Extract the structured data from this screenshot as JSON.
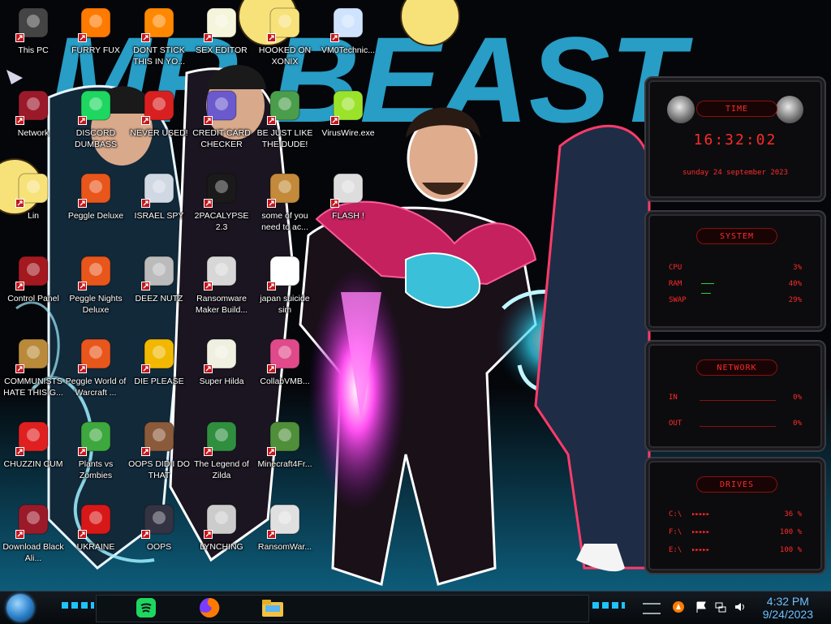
{
  "desktop": {
    "icons": [
      {
        "label": "This PC",
        "glyph": "computer-icon",
        "color": "#444"
      },
      {
        "label": "FURRY FUX",
        "glyph": "firefox-icon",
        "color": "#ff7a00"
      },
      {
        "label": "DONT STICK THIS IN YO...",
        "glyph": "vlc-icon",
        "color": "#ff8800"
      },
      {
        "label": "SEX EDITOR",
        "glyph": "editor-icon",
        "color": "#f5f5dc"
      },
      {
        "label": "HOOKED ON XONIX",
        "glyph": "cartoon-face-icon",
        "color": "#f7e27a"
      },
      {
        "label": "VM0Technic...",
        "glyph": "person-icon",
        "color": "#cfe3ff"
      },
      {
        "label": "Network",
        "glyph": "alien-orb-icon",
        "color": "#9b1a2a"
      },
      {
        "label": "DISCORD DUMBASS",
        "glyph": "spotify-icon",
        "color": "#1ed760"
      },
      {
        "label": "NEVER USED!",
        "glyph": "dev-cpp-icon",
        "color": "#d92020"
      },
      {
        "label": "CREDIT CARD CHECKER",
        "glyph": "credit-card-icon",
        "color": "#6a5acd"
      },
      {
        "label": "BE JUST LIKE THE DUDE!",
        "glyph": "character-icon",
        "color": "#4a9d4a"
      },
      {
        "label": "VirusWire.exe",
        "glyph": "lime-icon",
        "color": "#9be32b"
      },
      {
        "label": "Lin",
        "glyph": "cartoon-girl-icon",
        "color": "#f7e27a"
      },
      {
        "label": "Peggle Deluxe",
        "glyph": "peggle-icon",
        "color": "#e8561c"
      },
      {
        "label": "ISRAEL SPY",
        "glyph": "network-drive-icon",
        "color": "#cfd8e3"
      },
      {
        "label": "2PACALYPSE 2.3",
        "glyph": "terminal-icon",
        "color": "#1a1a1a"
      },
      {
        "label": "some of you need to ac...",
        "glyph": "dog-icon",
        "color": "#c28a3a"
      },
      {
        "label": "FLASH !",
        "glyph": "flash-icon",
        "color": "#dddddd"
      },
      {
        "label": "Control Panel",
        "glyph": "control-panel-icon",
        "color": "#a41820"
      },
      {
        "label": "Peggle Nights Deluxe",
        "glyph": "peggle-icon",
        "color": "#e8561c"
      },
      {
        "label": "DEEZ NUTZ",
        "glyph": "windows-stack-icon",
        "color": "#bbbbbb"
      },
      {
        "label": "Ransomware Maker Build...",
        "glyph": "app-window-icon",
        "color": "#d7d7d7"
      },
      {
        "label": "japan suicide sim",
        "glyph": "document-icon",
        "color": "#ffffff"
      },
      {
        "label": "COMMUNISTS HATE THIS G...",
        "glyph": "money-bag-icon",
        "color": "#b98a3a"
      },
      {
        "label": "Peggle World of Warcraft ...",
        "glyph": "peggle-icon",
        "color": "#e8561c"
      },
      {
        "label": "DIE PLEASE",
        "glyph": "dreamweaver-icon",
        "color": "#f2b800"
      },
      {
        "label": "Super Hilda",
        "glyph": "pixel-art-icon",
        "color": "#f0f0e0"
      },
      {
        "label": "CollabVMB...",
        "glyph": "monitor-icon",
        "color": "#e04a8a"
      },
      {
        "label": "CHUZZIN CUM",
        "glyph": "chuzzle-icon",
        "color": "#e02020"
      },
      {
        "label": "Plants vs Zombies",
        "glyph": "plant-icon",
        "color": "#3da83d"
      },
      {
        "label": "OOPS DID I DO THAT",
        "glyph": "portrait-icon",
        "color": "#8a5a3a"
      },
      {
        "label": "The Legend of Zilda",
        "glyph": "pixel-hero-icon",
        "color": "#2f8f3f"
      },
      {
        "label": "Minecraft4Fr...",
        "glyph": "minecraft-icon",
        "color": "#4f8f3a"
      },
      {
        "label": "Download Black Ali...",
        "glyph": "alien-orb-icon",
        "color": "#9b1a2a"
      },
      {
        "label": "UKRAINE",
        "glyph": "radiation-icon",
        "color": "#d81818"
      },
      {
        "label": "OOPS",
        "glyph": "monitor-dark-icon",
        "color": "#333344"
      },
      {
        "label": "LYNCHING",
        "glyph": "globe-flag-icon",
        "color": "#cccccc"
      },
      {
        "label": "RansomWar...",
        "glyph": "skull-icon",
        "color": "#e0e0e0"
      }
    ]
  },
  "widgets": {
    "time": {
      "title": "TIME",
      "clock": "16:32:02",
      "date": "sunday 24 september 2023"
    },
    "system": {
      "title": "SYSTEM",
      "rows": [
        {
          "k": "CPU",
          "v": "3%"
        },
        {
          "k": "RAM",
          "v": "40%"
        },
        {
          "k": "SWAP",
          "v": "29%"
        }
      ],
      "ram_level": 0.4,
      "swap_level": 0.29
    },
    "network": {
      "title": "NETWORK",
      "rows": [
        {
          "k": "IN",
          "v": "0%"
        },
        {
          "k": "OUT",
          "v": "0%"
        }
      ]
    },
    "drives": {
      "title": "DRIVES",
      "rows": [
        {
          "k": "C:\\",
          "v": "36 %"
        },
        {
          "k": "F:\\",
          "v": "100 %"
        },
        {
          "k": "E:\\",
          "v": "100 %"
        }
      ]
    }
  },
  "wallpaper": {
    "title_text": "MR BEAST"
  },
  "taskbar": {
    "apps": [
      {
        "name": "spotify",
        "color": "#1ed760"
      },
      {
        "name": "firefox",
        "color": "#ff7a00"
      },
      {
        "name": "file-explorer",
        "color": "#f3c242"
      }
    ],
    "tray": [
      "avast-icon",
      "flag-icon",
      "network-icon",
      "volume-icon"
    ],
    "time": "4:32 PM",
    "date": "9/24/2023"
  },
  "colors": {
    "accent": "#ff2a2a",
    "clock": "#6cc0ff",
    "glow_pink": "#ff2fd0",
    "glow_cyan": "#38e0ff"
  }
}
